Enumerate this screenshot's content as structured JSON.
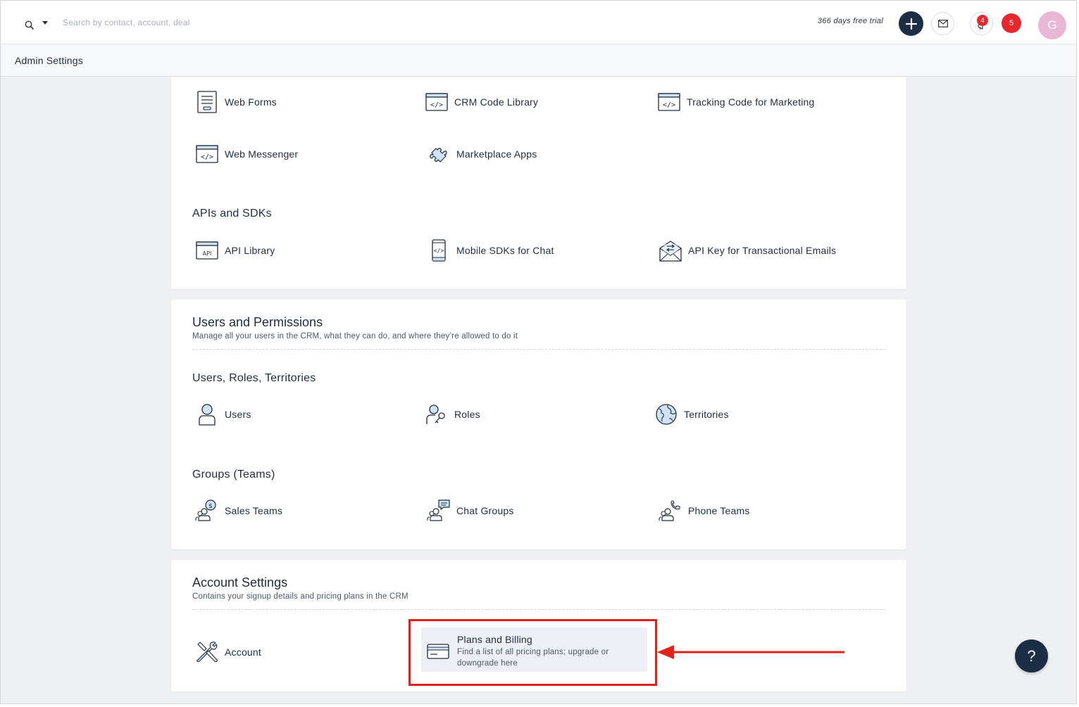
{
  "topbar": {
    "search_placeholder": "Search by contact, account, deal",
    "trial_text": "366 days free trial",
    "notifications_badge": "4",
    "alerts_count": "5",
    "avatar_initial": "G"
  },
  "subheader": {
    "title": "Admin Settings"
  },
  "integrations": {
    "items": [
      {
        "label": "Web Forms",
        "icon": "web-form-icon"
      },
      {
        "label": "CRM Code Library",
        "icon": "code-window-icon"
      },
      {
        "label": "Tracking Code for Marketing",
        "icon": "code-window-icon"
      },
      {
        "label": "Web Messenger",
        "icon": "code-window-icon"
      },
      {
        "label": "Marketplace Apps",
        "icon": "puzzle-icon"
      }
    ],
    "apis_group": {
      "title": "APIs and SDKs",
      "items": [
        {
          "label": "API Library",
          "icon": "api-window-icon",
          "icon_text": "API"
        },
        {
          "label": "Mobile SDKs for Chat",
          "icon": "mobile-code-icon"
        },
        {
          "label": "API Key for Transactional Emails",
          "icon": "envelope-swap-icon"
        }
      ]
    }
  },
  "users_permissions": {
    "title": "Users and Permissions",
    "description": "Manage all your users in the CRM, what they can do, and where they’re allowed to do it",
    "groups": [
      {
        "title": "Users, Roles, Territories",
        "items": [
          {
            "label": "Users",
            "icon": "user-icon"
          },
          {
            "label": "Roles",
            "icon": "user-key-icon"
          },
          {
            "label": "Territories",
            "icon": "globe-icon"
          }
        ]
      },
      {
        "title": "Groups (Teams)",
        "items": [
          {
            "label": "Sales Teams",
            "icon": "sales-team-icon"
          },
          {
            "label": "Chat Groups",
            "icon": "chat-group-icon"
          },
          {
            "label": "Phone Teams",
            "icon": "phone-team-icon"
          }
        ]
      }
    ]
  },
  "account_settings": {
    "title": "Account Settings",
    "description": "Contains your signup details and pricing plans in the CRM",
    "items": [
      {
        "label": "Account",
        "icon": "tools-icon"
      }
    ],
    "plans": {
      "label": "Plans and Billing",
      "description": "Find a list of all pricing plans; upgrade or downgrade here",
      "icon": "credit-card-icon"
    }
  },
  "annotation": {
    "highlight_color": "#e3221a"
  },
  "help": {
    "label": "?"
  },
  "colors": {
    "icon_stroke": "#1f2d3d",
    "icon_fill": "#cfe3f5",
    "accent_dark": "#1b2e45",
    "badge_red": "#e8262e"
  }
}
